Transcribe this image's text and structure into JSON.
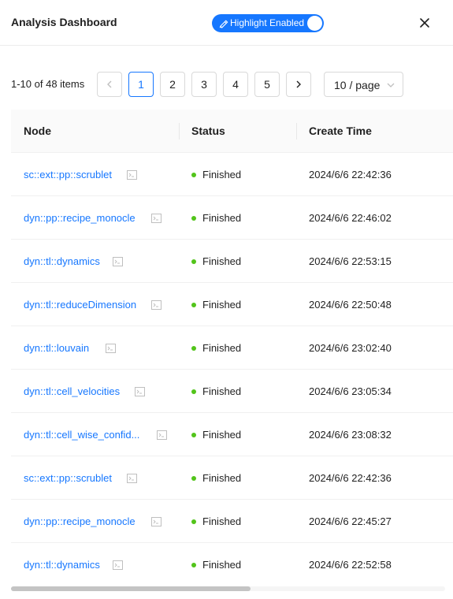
{
  "header": {
    "title": "Analysis Dashboard",
    "highlight_toggle": {
      "label": "Highlight Enabled",
      "on": true,
      "icon": "highlighter-icon"
    },
    "close_icon": "close-icon"
  },
  "pagination": {
    "total_text": "1-10 of 48 items",
    "pages": [
      "1",
      "2",
      "3",
      "4",
      "5"
    ],
    "current_page": "1",
    "page_size": "10 / page"
  },
  "table": {
    "columns": [
      "Node",
      "Status",
      "Create Time"
    ],
    "rows": [
      {
        "node": "sc::ext::pp::scrublet",
        "status": "Finished",
        "create_time": "2024/6/6 22:42:36"
      },
      {
        "node": "dyn::pp::recipe_monocle",
        "status": "Finished",
        "create_time": "2024/6/6 22:46:02"
      },
      {
        "node": "dyn::tl::dynamics",
        "status": "Finished",
        "create_time": "2024/6/6 22:53:15"
      },
      {
        "node": "dyn::tl::reduceDimension",
        "status": "Finished",
        "create_time": "2024/6/6 22:50:48"
      },
      {
        "node": "dyn::tl::louvain",
        "status": "Finished",
        "create_time": "2024/6/6 23:02:40"
      },
      {
        "node": "dyn::tl::cell_velocities",
        "status": "Finished",
        "create_time": "2024/6/6 23:05:34"
      },
      {
        "node": "dyn::tl::cell_wise_confid...",
        "status": "Finished",
        "create_time": "2024/6/6 23:08:32"
      },
      {
        "node": "sc::ext::pp::scrublet",
        "status": "Finished",
        "create_time": "2024/6/6 22:42:36"
      },
      {
        "node": "dyn::pp::recipe_monocle",
        "status": "Finished",
        "create_time": "2024/6/6 22:45:27"
      },
      {
        "node": "dyn::tl::dynamics",
        "status": "Finished",
        "create_time": "2024/6/6 22:52:58"
      }
    ]
  },
  "colors": {
    "accent": "#1677ff",
    "finished": "#52c41a"
  }
}
